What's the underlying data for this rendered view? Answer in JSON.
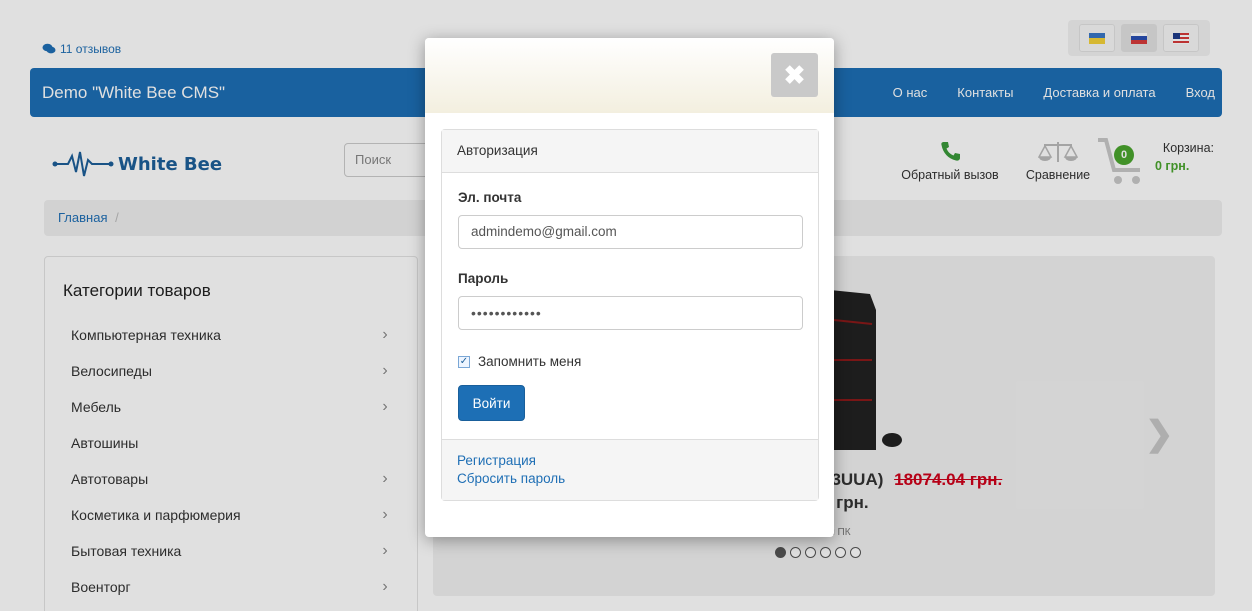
{
  "reviews": {
    "label": "11 отзывов"
  },
  "languages": [
    {
      "code": "uk",
      "colors": [
        "#3a77c6",
        "#f4d23a"
      ]
    },
    {
      "code": "ru",
      "colors": [
        "#ffffff",
        "#2a4fb3",
        "#d63b3b"
      ]
    },
    {
      "code": "en",
      "colors": [
        "#1f3c8a",
        "#d63b3b"
      ]
    }
  ],
  "navbar": {
    "brand": "Demo \"White Bee CMS\"",
    "links": [
      "О нас",
      "Контакты",
      "Доставка и оплата",
      "Вход"
    ]
  },
  "header": {
    "logo_text": "White Bee",
    "search_placeholder": "Поиск",
    "callback_label": "Обратный вызов",
    "compare_label": "Сравнение",
    "cart_label": "Корзина:",
    "cart_count": "0",
    "cart_sum": "0 грн."
  },
  "breadcrumb": {
    "home": "Главная",
    "separator": "/"
  },
  "categories": {
    "title": "Категории товаров",
    "items": [
      {
        "label": "Компьютерная техника",
        "has_children": true
      },
      {
        "label": "Велосипеды",
        "has_children": true
      },
      {
        "label": "Мебель",
        "has_children": true
      },
      {
        "label": "Автошины",
        "has_children": false
      },
      {
        "label": "Автотовары",
        "has_children": true
      },
      {
        "label": "Косметика и парфюмерия",
        "has_children": true
      },
      {
        "label": "Бытовая техника",
        "has_children": true
      },
      {
        "label": "Военторг",
        "has_children": true
      }
    ]
  },
  "slider": {
    "product_name_fragment": "03UUA)",
    "old_price": "18074.04 грн.",
    "price_fragment": "0 грн.",
    "subtitle_fragment": "ый ПК",
    "dots_total": 6,
    "active_dot": 0
  },
  "modal": {
    "panel_title": "Авторизация",
    "email_label": "Эл. почта",
    "email_value": "admindemo@gmail.com",
    "password_label": "Пароль",
    "password_value": "••••••••••••",
    "remember_label": "Запомнить меня",
    "remember_checked": true,
    "login_button": "Войти",
    "register_link": "Регистрация",
    "reset_link": "Сбросить пароль"
  },
  "colors": {
    "primary": "#1d6fb5",
    "cart_green": "#4aa52e",
    "sale_red": "#d0021b"
  }
}
